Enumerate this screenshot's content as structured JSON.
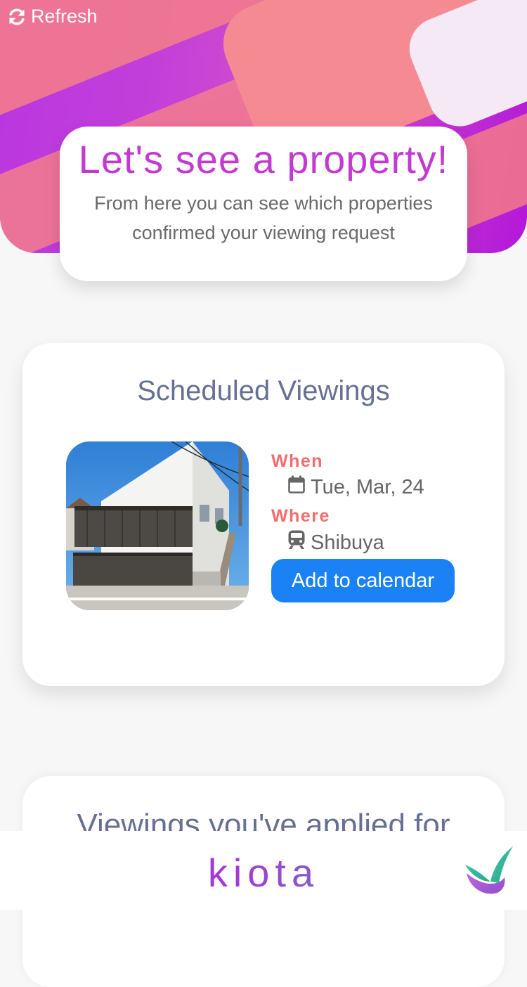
{
  "header": {
    "refresh_label": "Refresh",
    "refresh_icon": "refresh-icon"
  },
  "intro": {
    "title": "Let's see a property!",
    "subtitle": "From here you can see which properties confirmed your viewing request"
  },
  "scheduled": {
    "title": "Scheduled Viewings",
    "items": [
      {
        "when_label": "When",
        "date": "Tue, Mar, 24",
        "date_icon": "calendar-icon",
        "where_label": "Where",
        "location": "Shibuya",
        "location_icon": "train-icon",
        "button_label": "Add to calendar"
      }
    ]
  },
  "applied": {
    "title": "Viewings you've applied for"
  },
  "footer": {
    "brand": "kiota",
    "check_icon": "check-logo-icon"
  },
  "colors": {
    "accent_pink": "#f26d6d",
    "primary_blue": "#1a82f5",
    "title_purple": "#c23bd0",
    "heading_slate": "#667092"
  }
}
